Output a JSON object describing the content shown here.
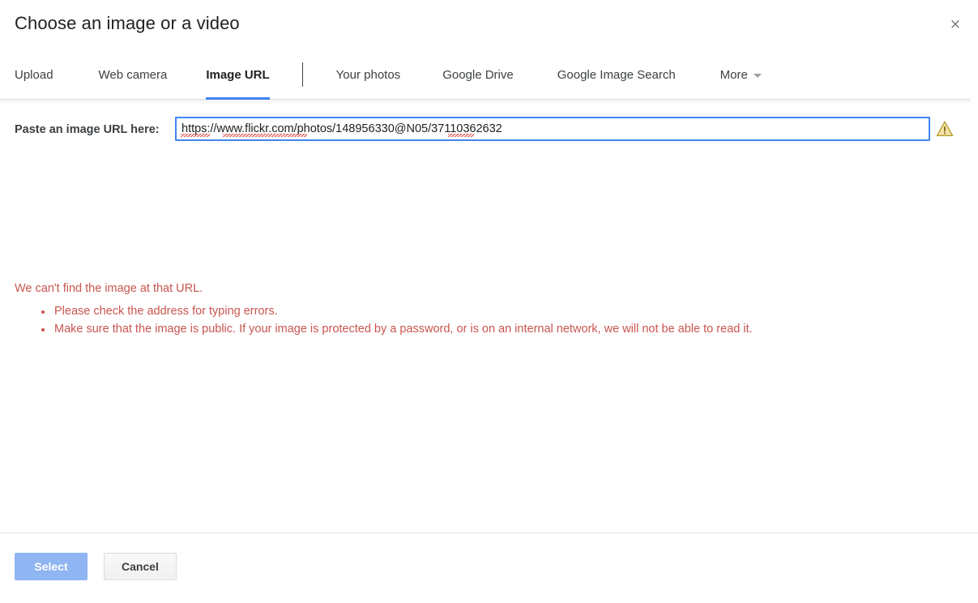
{
  "dialog": {
    "title": "Choose an image or a video",
    "close_label": "×"
  },
  "tabs": [
    {
      "label": "Upload",
      "active": false
    },
    {
      "label": "Web camera",
      "active": false
    },
    {
      "label": "Image URL",
      "active": true
    },
    {
      "label": "Your photos",
      "active": false
    },
    {
      "label": "Google Drive",
      "active": false
    },
    {
      "label": "Google Image Search",
      "active": false
    },
    {
      "label": "More",
      "active": false,
      "caret": true
    }
  ],
  "url_section": {
    "label": "Paste an image URL here:",
    "value": "https://www.flickr.com/photos/148956330@N05/37110362632",
    "placeholder": "Paste an image URL here",
    "warning_icon": "warning-triangle-icon"
  },
  "error": {
    "headline": "We can't find the image at that URL.",
    "items": [
      "Please check the address for typing errors.",
      "Make sure that the image is public. If your image is protected by a password, or is on an internal network, we will not be able to read it."
    ]
  },
  "footer": {
    "select_label": "Select",
    "cancel_label": "Cancel"
  },
  "colors": {
    "accent_blue": "#4285f4",
    "select_disabled": "#8fb5f2",
    "error_red": "#c9554f",
    "warning_amber": "#e8c03a",
    "text_primary": "#202124"
  }
}
